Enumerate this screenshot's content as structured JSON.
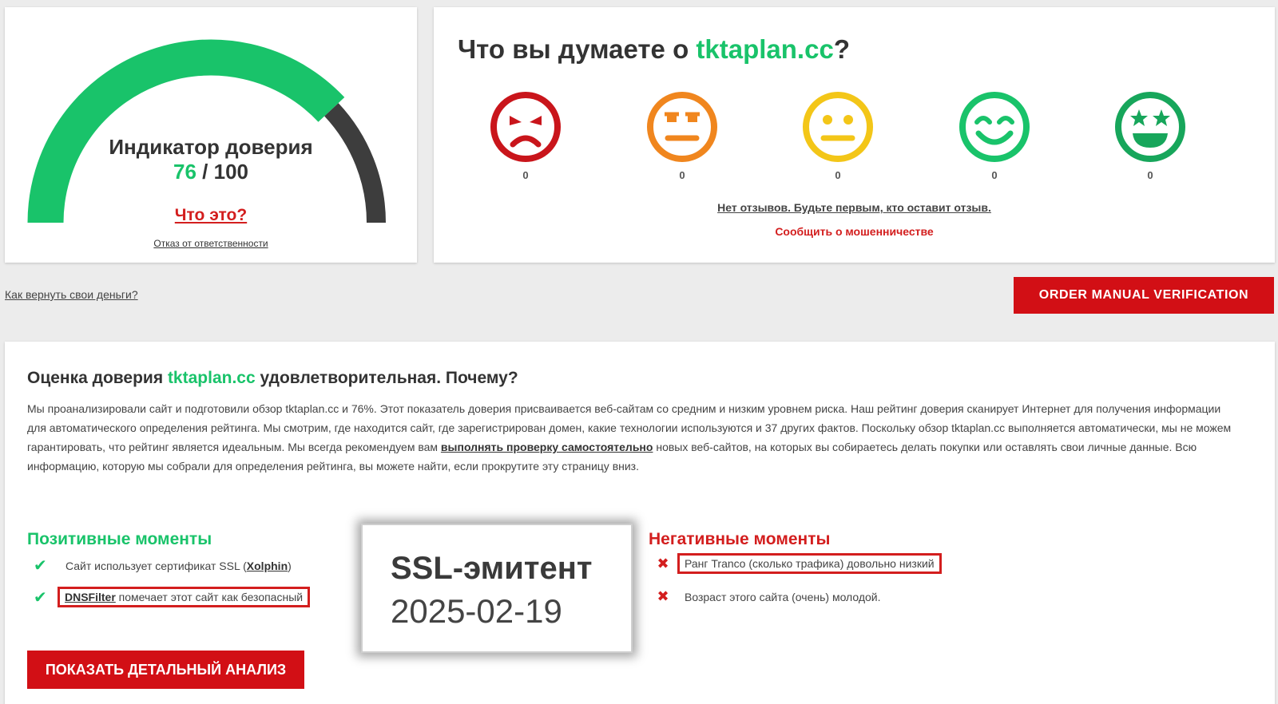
{
  "trust": {
    "title": "Индикатор доверия",
    "score": "76",
    "max": "/ 100",
    "score_fraction": 0.76,
    "what_is_it": "Что это?",
    "disclaimer": "Отказ от ответственности",
    "colors": {
      "fill": "#19c36a",
      "rest": "#3d3d3d"
    }
  },
  "review": {
    "question_prefix": "Что вы думаете о ",
    "domain": "tktaplan.cc",
    "question_suffix": "?",
    "emojis": [
      {
        "icon": "angry-face-icon",
        "color": "#c9151b",
        "count": "0"
      },
      {
        "icon": "annoyed-face-icon",
        "color": "#f0861e",
        "count": "0"
      },
      {
        "icon": "neutral-face-icon",
        "color": "#f3c618",
        "count": "0"
      },
      {
        "icon": "happy-face-icon",
        "color": "#19c36a",
        "count": "0"
      },
      {
        "icon": "star-eyes-face-icon",
        "color": "#17a65b",
        "count": "0"
      }
    ],
    "no_reviews": "Нет отзывов. Будьте первым, кто оставит отзыв.",
    "report_fraud": "Сообщить о мошенничестве"
  },
  "refund_link": "Как вернуть свои деньги?",
  "order_button": "ORDER MANUAL VERIFICATION",
  "analysis": {
    "title_prefix": "Оценка доверия ",
    "domain": "tktaplan.cc",
    "title_suffix": " удовлетворительная. Почему?",
    "text_part1": "Мы проанализировали сайт и подготовили обзор tktaplan.cc и 76%. Этот показатель доверия присваивается веб-сайтам со средним и низким уровнем риска. Наш рейтинг доверия сканирует Интернет для получения информации для автоматического определения рейтинга. Мы смотрим, где находится сайт, где зарегистрирован домен, какие технологии используются и 37 других фактов. Поскольку обзор tktaplan.cc выполняется автоматически, мы не можем гарантировать, что рейтинг является идеальным. Мы всегда рекомендуем вам ",
    "text_link": "выполнять проверку самостоятельно",
    "text_part2": " новых веб-сайтов, на которых вы собираетесь делать покупки или оставлять свои личные данные. Всю информацию, которую мы собрали для определения рейтинга, вы можете найти, если прокрутите эту страницу вниз.",
    "positive_heading": "Позитивные моменты",
    "positive": {
      "ssl_prefix": "Сайт использует сертификат SSL (",
      "ssl_issuer": "Xolphin",
      "ssl_suffix": ")",
      "dns_name": "DNSFilter",
      "dns_text": " помечает этот сайт как безопасный"
    },
    "negative_heading": "Негативные моменты",
    "negative": [
      "Ранг Tranco (сколько трафика) довольно низкий",
      "Возраст этого сайта (очень) молодой."
    ],
    "ssl_label": "SSL-эмитент",
    "ssl_date": "2025-02-19",
    "detail_button": "ПОКАЗАТЬ ДЕТАЛЬНЫЙ АНАЛИЗ"
  }
}
